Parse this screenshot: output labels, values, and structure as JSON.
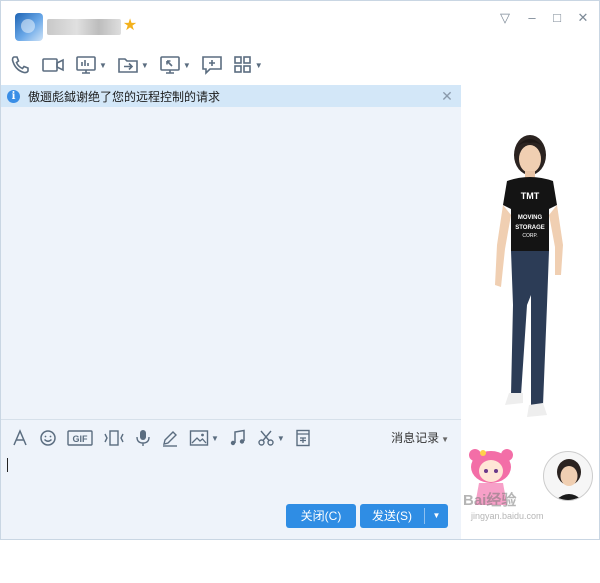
{
  "header": {
    "window_controls": [
      "▽",
      "–",
      "□",
      "✕"
    ]
  },
  "toolbar_top": {
    "icons": [
      "phone-icon",
      "video-icon",
      "screen-share-icon",
      "transfer-file-icon",
      "remote-desktop-icon",
      "message-add-icon",
      "apps-icon"
    ]
  },
  "notice": {
    "text": "傲逦彪鉞谢绝了您的远程控制的请求",
    "icon": "i"
  },
  "input_toolbar": {
    "icons": [
      "font-icon",
      "emoji-icon",
      "gif-icon",
      "shake-icon",
      "voice-icon",
      "handwrite-icon",
      "image-icon",
      "music-icon",
      "screenshot-icon",
      "red-packet-icon"
    ],
    "gif_label": "GIF",
    "history_label": "消息记录"
  },
  "buttons": {
    "close_label": "关闭(C)",
    "send_label": "发送(S)"
  },
  "side": {
    "shirt_line1": "TMT",
    "shirt_line2": "MOVING",
    "shirt_line3": "STORAGE",
    "shirt_line4": "CORP.",
    "watermark": "Bai经验",
    "watermark_url": "jingyan.baidu.com"
  },
  "colors": {
    "accent": "#2f8de4",
    "chat_bg": "#eef3fa",
    "notice_bg": "#d3e7f8"
  }
}
